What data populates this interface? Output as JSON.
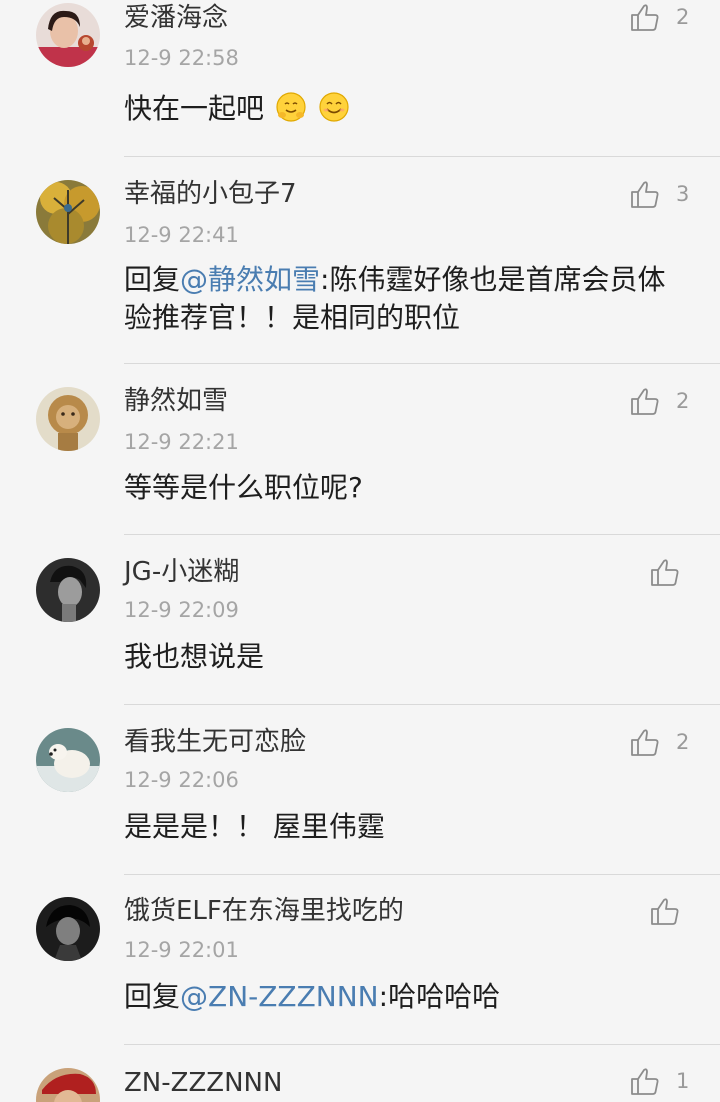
{
  "comments": [
    {
      "username": "爱潘海念",
      "time": "12-9 22:58",
      "text": "快在一起吧",
      "emojis": [
        "hugging-face-emoji",
        "smiling-face-emoji"
      ],
      "likes": "2"
    },
    {
      "username": "幸福的小包子7",
      "time": "12-9 22:41",
      "reply_prefix": "回复",
      "mention": "@静然如雪",
      "text": ":陈伟霆好像也是首席会员体验推荐官！！是相同的职位",
      "likes": "3"
    },
    {
      "username": "静然如雪",
      "time": "12-9 22:21",
      "text": "等等是什么职位呢?",
      "likes": "2"
    },
    {
      "username": "JG-小迷糊",
      "time": "12-9 22:09",
      "text": "我也想说是",
      "likes": ""
    },
    {
      "username": "看我生无可恋脸",
      "time": "12-9 22:06",
      "text": "是是是！！ 屋里伟霆",
      "likes": "2"
    },
    {
      "username": "饿货ELF在东海里找吃的",
      "time": "12-9 22:01",
      "reply_prefix": "回复",
      "mention": "@ZN-ZZZNNN",
      "text": ":哈哈哈哈",
      "likes": ""
    },
    {
      "username": "ZN-ZZZNNN",
      "likes": "1"
    }
  ],
  "icons": {
    "like": "thumbs-up-icon"
  },
  "colors": {
    "mention": "#4a7db1",
    "time": "#a5a5a5",
    "background": "#f5f5f5"
  }
}
